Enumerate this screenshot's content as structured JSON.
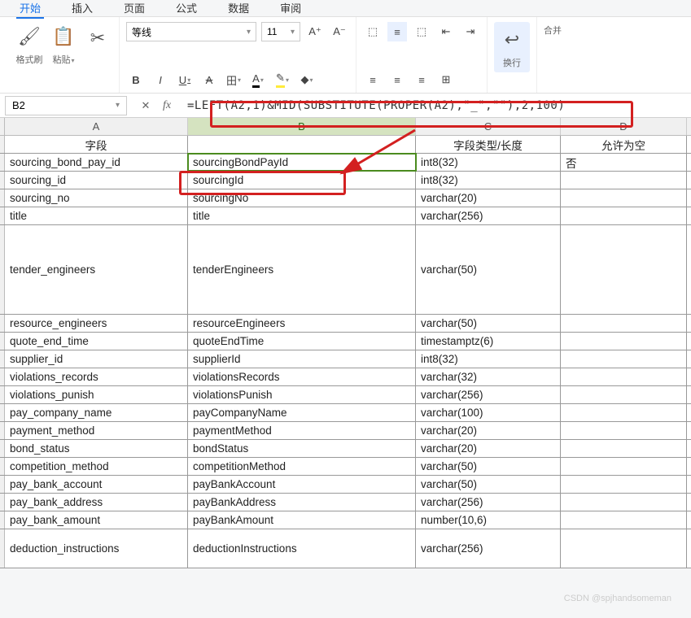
{
  "menu": {
    "tabs": [
      "开始",
      "插入",
      "页面",
      "公式",
      "数据",
      "审阅"
    ],
    "active": "开始"
  },
  "ribbon": {
    "format_painter": "格式刷",
    "paste": "粘贴",
    "font_name": "等线",
    "font_size": "11",
    "wrap": "换行",
    "merge": "合并"
  },
  "namebox": "B2",
  "formula": "=LEFT(A2,1)&MID(SUBSTITUTE(PROPER(A2),\"_\",\"\"),2,100)",
  "columns": [
    "A",
    "B",
    "C",
    "D"
  ],
  "headers": {
    "a": "字段",
    "b": "",
    "c": "字段类型/长度",
    "d": "允许为空"
  },
  "rows": [
    {
      "a": "sourcing_bond_pay_id",
      "b": "sourcingBondPayId",
      "c": "int8(32)",
      "d": "否",
      "h": "normal",
      "sel": true
    },
    {
      "a": "sourcing_id",
      "b": "sourcingId",
      "c": "int8(32)",
      "d": "",
      "h": "normal"
    },
    {
      "a": "sourcing_no",
      "b": "sourcingNo",
      "c": "varchar(20)",
      "d": "",
      "h": "normal"
    },
    {
      "a": "title",
      "b": "title",
      "c": "varchar(256)",
      "d": "",
      "h": "normal"
    },
    {
      "a": "tender_engineers",
      "b": "tenderEngineers",
      "c": "varchar(50)",
      "d": "",
      "h": "tall"
    },
    {
      "a": "resource_engineers",
      "b": "resourceEngineers",
      "c": "varchar(50)",
      "d": "",
      "h": "normal"
    },
    {
      "a": "quote_end_time",
      "b": "quoteEndTime",
      "c": "timestamptz(6)",
      "d": "",
      "h": "normal"
    },
    {
      "a": "supplier_id",
      "b": "supplierId",
      "c": "int8(32)",
      "d": "",
      "h": "normal"
    },
    {
      "a": "violations_records",
      "b": "violationsRecords",
      "c": "varchar(32)",
      "d": "",
      "h": "normal"
    },
    {
      "a": "violations_punish",
      "b": "violationsPunish",
      "c": "varchar(256)",
      "d": "",
      "h": "normal"
    },
    {
      "a": "pay_company_name",
      "b": "payCompanyName",
      "c": "varchar(100)",
      "d": "",
      "h": "normal"
    },
    {
      "a": "payment_method",
      "b": "paymentMethod",
      "c": "varchar(20)",
      "d": "",
      "h": "normal"
    },
    {
      "a": "bond_status",
      "b": "bondStatus",
      "c": "varchar(20)",
      "d": "",
      "h": "normal"
    },
    {
      "a": "competition_method",
      "b": "competitionMethod",
      "c": "varchar(50)",
      "d": "",
      "h": "normal"
    },
    {
      "a": "pay_bank_account",
      "b": "payBankAccount",
      "c": "varchar(50)",
      "d": "",
      "h": "normal"
    },
    {
      "a": "pay_bank_address",
      "b": "payBankAddress",
      "c": "varchar(256)",
      "d": "",
      "h": "normal"
    },
    {
      "a": "pay_bank_amount",
      "b": "payBankAmount",
      "c": "number(10,6)",
      "d": "",
      "h": "normal"
    },
    {
      "a": "deduction_instructions",
      "b": "deductionInstructions",
      "c": "varchar(256)",
      "d": "",
      "h": "tall2"
    }
  ],
  "watermark": "CSDN @spjhandsomeman"
}
